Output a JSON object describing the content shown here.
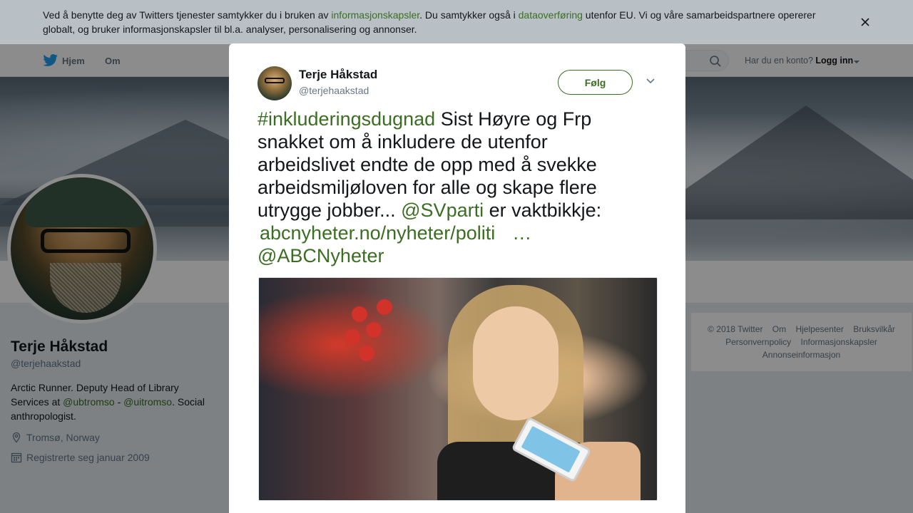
{
  "cookie_banner": {
    "text_part1": "Ved å benytte deg av Twitters tjenester samtykker du i bruken av ",
    "link_cookies": "informasjonskapsler",
    "text_part2": ". Du samtykker også i ",
    "link_transfer": "dataoverføring",
    "text_part3": " utenfor EU. Vi og våre samarbeidspartnere opererer globalt, og bruker informasjonskapsler til bl.a. analyser, personalisering og annonser."
  },
  "topnav": {
    "home": "Hjem",
    "about": "Om",
    "login_question": "Har du en konto?",
    "login_link": "Logg inn"
  },
  "profile": {
    "name": "Terje Håkstad",
    "handle": "@terjehaakstad",
    "bio_part1": "Arctic Runner. Deputy Head of Library Services at ",
    "bio_link1": "@ubtromso",
    "bio_sep": " - ",
    "bio_link2": "@uitromso",
    "bio_part2": ". Social anthropologist.",
    "location": "Tromsø, Norway",
    "joined": "Registrerte seg januar 2009"
  },
  "footer": {
    "copyright": "© 2018 Twitter",
    "about": "Om",
    "help": "Hjelpesenter",
    "terms": "Bruksvilkår",
    "privacy": "Personvernpolicy",
    "cookies": "Informasjonskapsler",
    "ads_info": "Annonseinformasjon"
  },
  "tweet": {
    "author_name": "Terje Håkstad",
    "author_handle": "@terjehaakstad",
    "follow_label": "Følg",
    "hashtag": "#inkluderingsdugnad",
    "text1": " Sist Høyre og Frp snakket om å inkludere de utenfor arbeidslivet endte de opp med å svekke arbeidsmiljøloven for alle og skape flere utrygge jobber... ",
    "mention1": "@SVparti",
    "text2": " er vaktbikkje: ",
    "url": "abcnyheter.no/nyheter/politi",
    "ellipsis": "…",
    "mention2": "@ABCNyheter"
  },
  "colors": {
    "link": "#3b6e22",
    "overlay": "rgba(0,0,0,0.45)"
  }
}
